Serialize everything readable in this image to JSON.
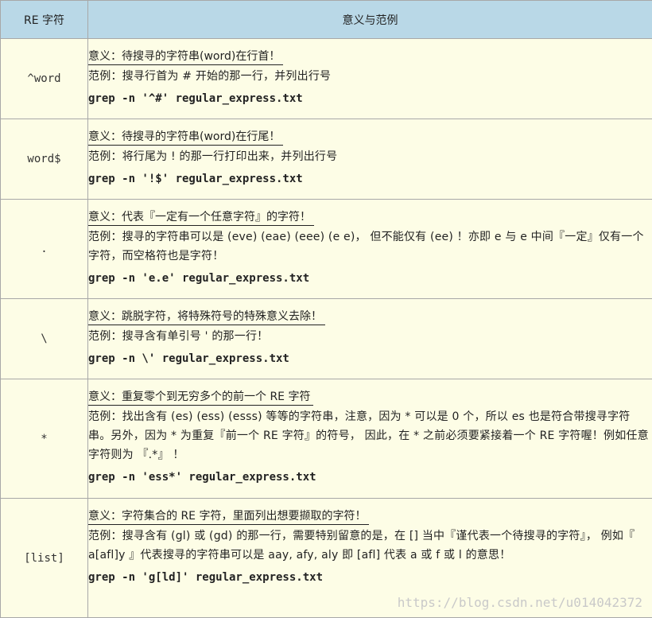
{
  "header": {
    "col1": "RE 字符",
    "col2": "意义与范例"
  },
  "rows": [
    {
      "symbol": "^word",
      "meaning": "意义：待搜寻的字符串(word)在行首！",
      "example": "范例：搜寻行首为 # 开始的那一行，并列出行号",
      "command": "grep -n '^#' regular_express.txt"
    },
    {
      "symbol": "word$",
      "meaning": "意义：待搜寻的字符串(word)在行尾！",
      "example": "范例：将行尾为 ! 的那一行打印出来，并列出行号",
      "command": "grep -n '!$' regular_express.txt"
    },
    {
      "symbol": ".",
      "meaning": "意义：代表『一定有一个任意字符』的字符！",
      "example": "范例：搜寻的字符串可以是 (eve) (eae) (eee) (e e)， 但不能仅有 (ee) ！亦即 e 与 e 中间『一定』仅有一个字符，而空格符也是字符！",
      "command": "grep -n 'e.e' regular_express.txt"
    },
    {
      "symbol": "\\",
      "meaning": "意义：跳脱字符，将特殊符号的特殊意义去除！",
      "example": "范例：搜寻含有单引号 ' 的那一行！",
      "command": "grep -n \\' regular_express.txt"
    },
    {
      "symbol": "*",
      "meaning": "意义：重复零个到无穷多个的前一个 RE 字符",
      "example": "范例：找出含有 (es) (ess) (esss) 等等的字符串，注意，因为 * 可以是 0 个，所以 es 也是符合带搜寻字符串。另外，因为 * 为重复『前一个 RE 字符』的符号， 因此，在 * 之前必须要紧接着一个 RE 字符喔！例如任意字符则为 『.*』 ！",
      "command": "grep -n 'ess*' regular_express.txt"
    },
    {
      "symbol": "[list]",
      "meaning": "意义：字符集合的 RE 字符，里面列出想要撷取的字符！",
      "example": "范例：搜寻含有 (gl) 或 (gd) 的那一行，需要特别留意的是，在 [] 当中『谨代表一个待搜寻的字符』， 例如『 a[afl]y 』代表搜寻的字符串可以是 aay, afy, aly 即 [afl] 代表 a 或 f 或 l 的意思！",
      "command": "grep -n 'g[ld]' regular_express.txt"
    }
  ],
  "watermark": "https://blog.csdn.net/u014042372"
}
